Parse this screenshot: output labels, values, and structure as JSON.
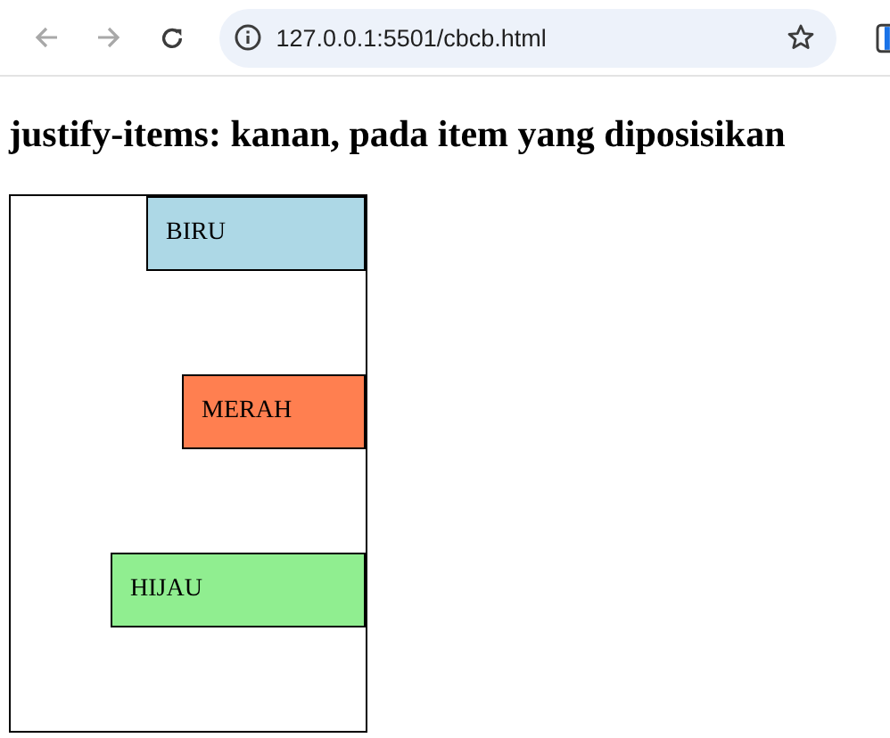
{
  "browser": {
    "back_disabled": true,
    "forward_disabled": true,
    "url": "127.0.0.1:5501/cbcb.html"
  },
  "heading": "justify-items: kanan, pada item yang diposisikan",
  "items": [
    {
      "label": "BIRU",
      "color": "#add8e6"
    },
    {
      "label": "MERAH",
      "color": "#ff7f50"
    },
    {
      "label": "HIJAU",
      "color": "#90ee90"
    }
  ]
}
